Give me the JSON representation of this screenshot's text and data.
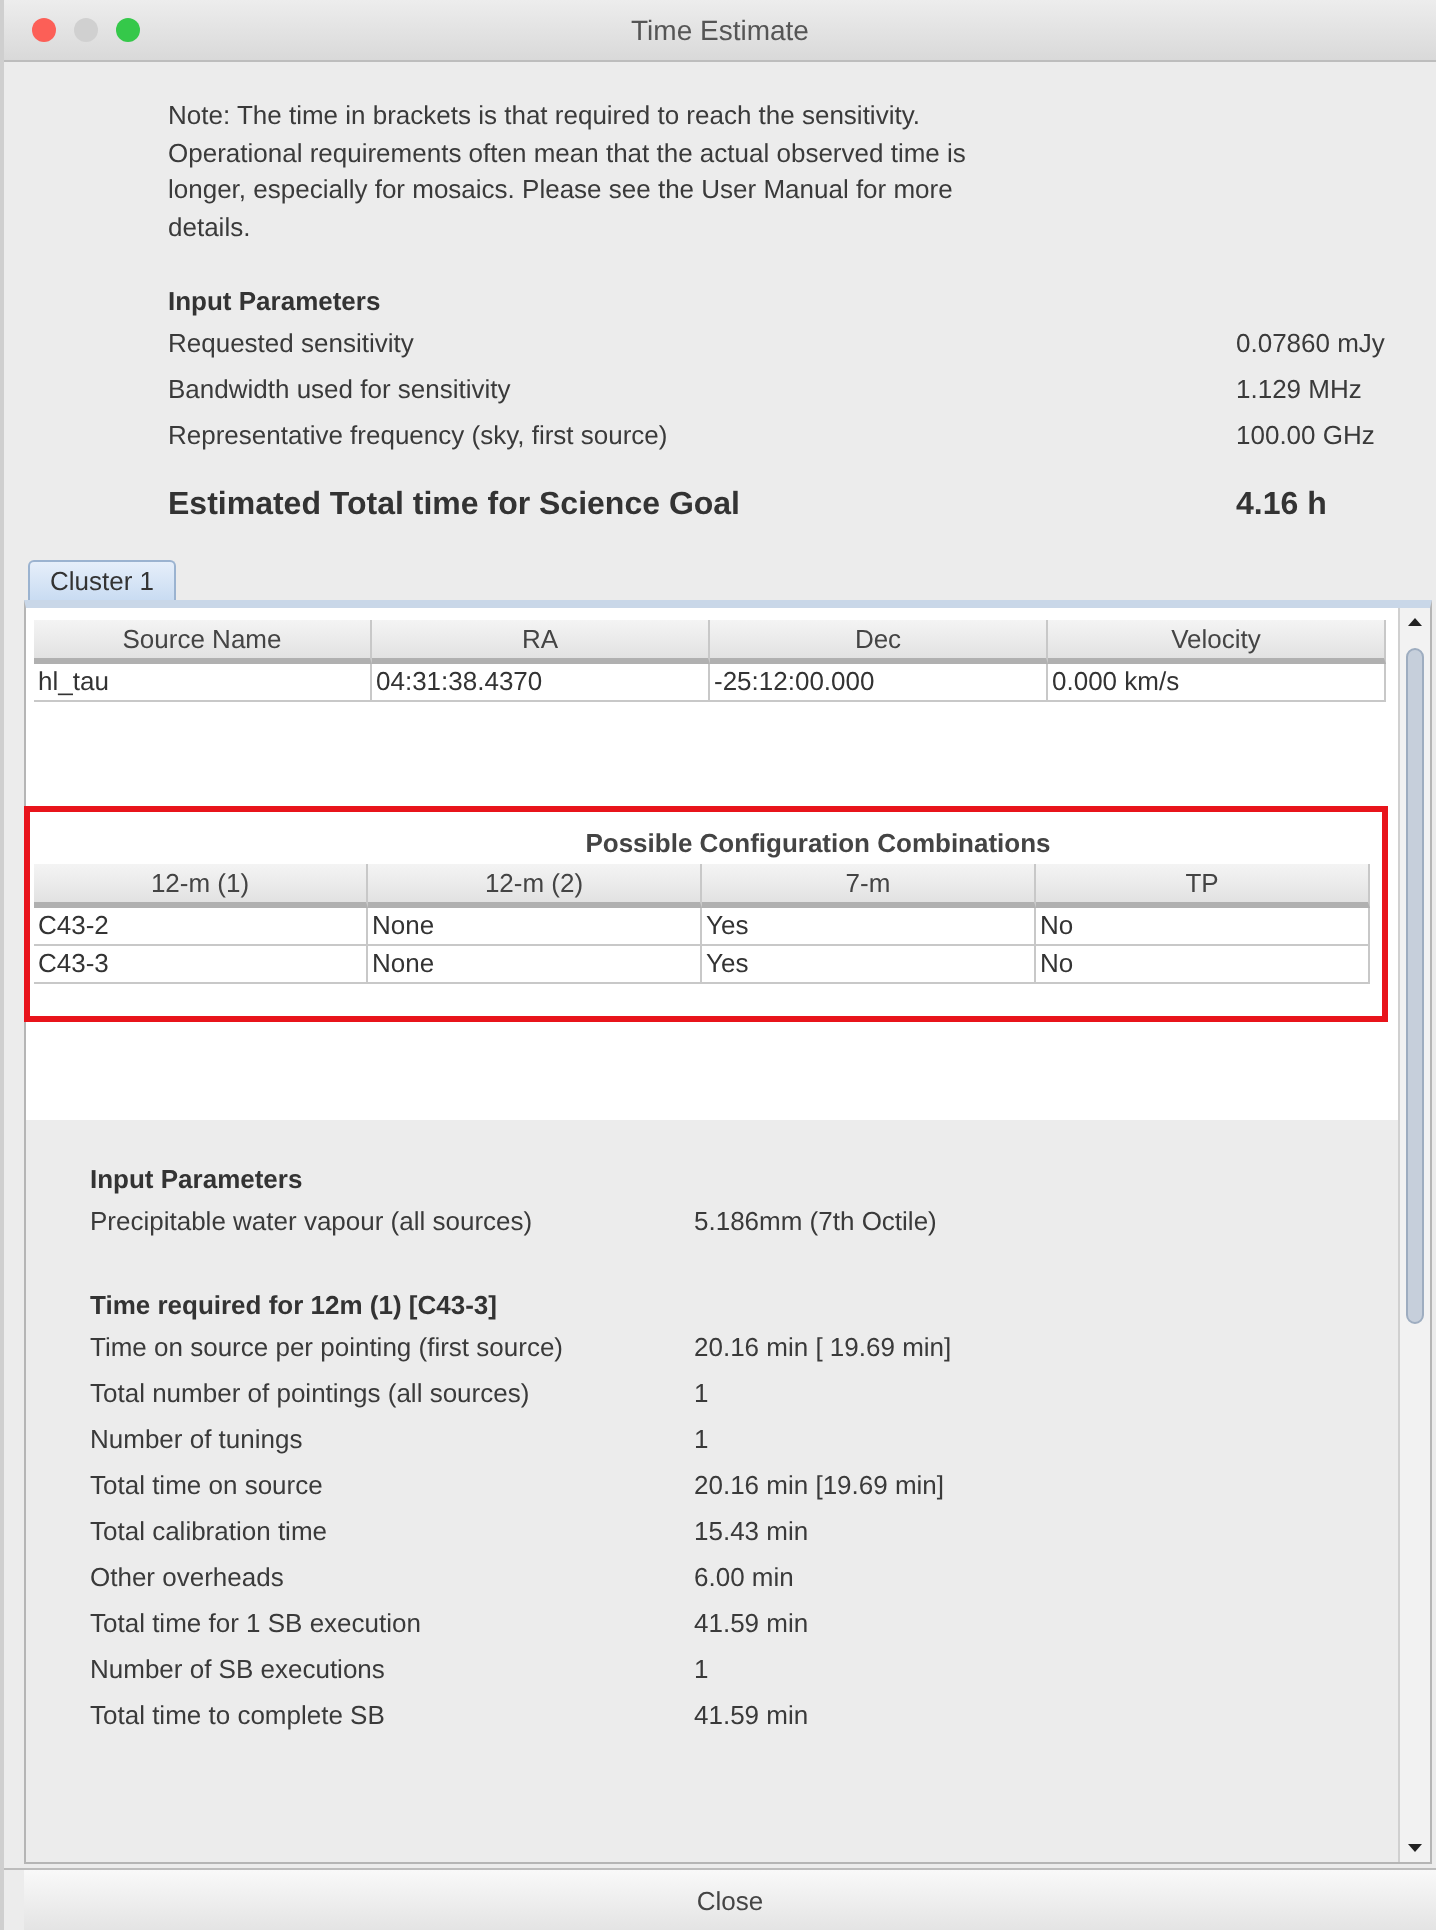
{
  "window": {
    "title": "Time Estimate"
  },
  "note": "Note: The time in brackets is that required to reach the sensitivity. Operational requirements often mean that the actual observed time is longer, especially for mosaics. Please see the User Manual for more details.",
  "summary": {
    "heading": "Input Parameters",
    "rows": [
      {
        "label": "Requested sensitivity",
        "value": "0.07860 mJy"
      },
      {
        "label": "Bandwidth used for sensitivity",
        "value": "1.129 MHz"
      },
      {
        "label": "Representative frequency (sky, first source)",
        "value": "100.00 GHz"
      }
    ],
    "total": {
      "label": "Estimated Total time for Science Goal",
      "value": "4.16 h"
    }
  },
  "tabs": [
    {
      "label": "Cluster 1",
      "selected": true
    }
  ],
  "sources": {
    "columns": [
      "Source Name",
      "RA",
      "Dec",
      "Velocity"
    ],
    "rows": [
      [
        "hl_tau",
        "04:31:38.4370",
        "-25:12:00.000",
        "0.000 km/s"
      ]
    ]
  },
  "configurations": {
    "title": "Possible Configuration Combinations",
    "highlighted": true,
    "columns": [
      "12-m (1)",
      "12-m (2)",
      "7-m",
      "TP"
    ],
    "rows": [
      [
        "C43-2",
        "None",
        "Yes",
        "No"
      ],
      [
        "C43-3",
        "None",
        "Yes",
        "No"
      ]
    ]
  },
  "details": [
    {
      "heading": "Input Parameters",
      "rows": [
        {
          "label": "Precipitable water vapour (all sources)",
          "value": "5.186mm (7th Octile)"
        }
      ]
    },
    {
      "heading": "Time required for 12m (1) [C43-3]",
      "rows": [
        {
          "label": "Time on source per pointing (first source)",
          "value": "20.16 min [ 19.69 min]"
        },
        {
          "label": "Total number of pointings (all sources)",
          "value": "1"
        },
        {
          "label": "Number of tunings",
          "value": "1"
        },
        {
          "label": "Total time on source",
          "value": "20.16 min [19.69 min]"
        },
        {
          "label": "Total calibration time",
          "value": "15.43 min"
        },
        {
          "label": "Other overheads",
          "value": "6.00 min"
        },
        {
          "label": "Total time for 1 SB execution",
          "value": "41.59 min"
        },
        {
          "label": "Number of SB executions",
          "value": "1"
        },
        {
          "label": "Total time to complete SB",
          "value": "41.59 min"
        }
      ]
    }
  ],
  "buttons": [
    {
      "label": "Close"
    }
  ]
}
